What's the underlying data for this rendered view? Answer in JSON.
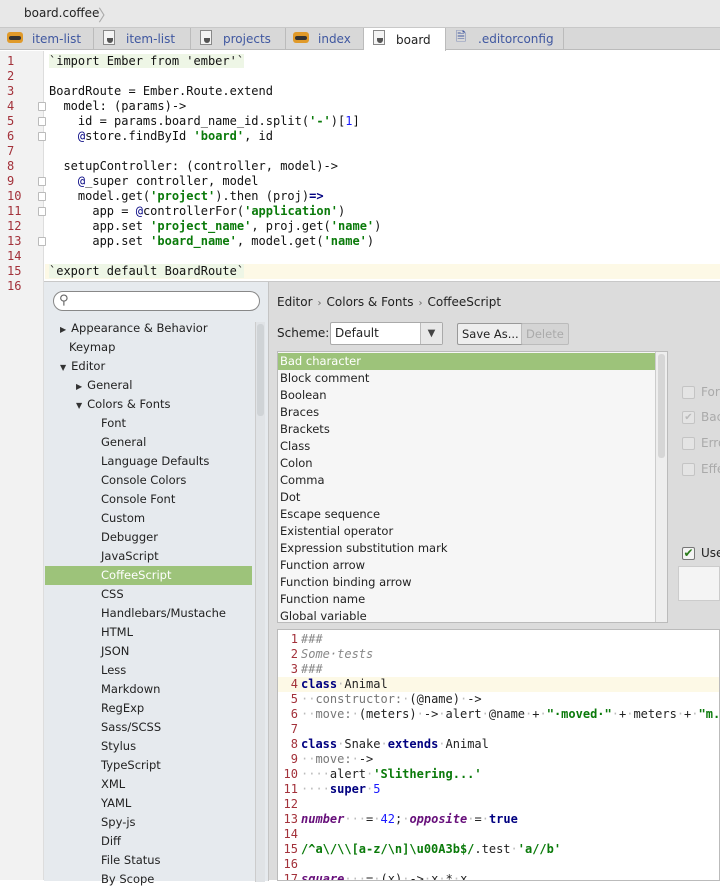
{
  "breadcrumb": {
    "file": "board.coffee"
  },
  "tabs": [
    {
      "label": "item-list",
      "icon": "mustache"
    },
    {
      "label": "item-list",
      "icon": "coffee-file"
    },
    {
      "label": "projects",
      "icon": "coffee-file"
    },
    {
      "label": "index",
      "icon": "mustache"
    },
    {
      "label": "board",
      "icon": "coffee-file",
      "active": true
    },
    {
      "label": ".editorconfig",
      "icon": "text-file"
    }
  ],
  "editor": {
    "line_numbers": [
      "1",
      "2",
      "3",
      "4",
      "5",
      "6",
      "7",
      "8",
      "9",
      "10",
      "11",
      "12",
      "13",
      "14",
      "15",
      "16"
    ],
    "current_line": 15,
    "lines": [
      [
        [
          "`import Ember from 'ember'`",
          "js"
        ]
      ],
      [],
      [
        [
          "BoardRoute = Ember.Route.extend",
          ""
        ]
      ],
      [
        [
          "  model: (params)->",
          ""
        ]
      ],
      [
        [
          "    id = params.board_name_id.split(",
          ""
        ],
        [
          "'-'",
          "str"
        ],
        [
          ")[",
          ""
        ],
        [
          "1",
          "num"
        ],
        [
          "]",
          ""
        ]
      ],
      [
        [
          "    ",
          ""
        ],
        [
          "@",
          "at"
        ],
        [
          "store.findById ",
          ""
        ],
        [
          "'board'",
          "str"
        ],
        [
          ", id",
          ""
        ]
      ],
      [],
      [
        [
          "  setupController: (controller, model)->",
          ""
        ]
      ],
      [
        [
          "    ",
          ""
        ],
        [
          "@",
          "at"
        ],
        [
          "_super controller, model",
          ""
        ]
      ],
      [
        [
          "    model.get(",
          ""
        ],
        [
          "'project'",
          "str"
        ],
        [
          ").then (proj)",
          ""
        ],
        [
          "=>",
          "kw"
        ]
      ],
      [
        [
          "      app = ",
          ""
        ],
        [
          "@",
          "at"
        ],
        [
          "controllerFor(",
          ""
        ],
        [
          "'application'",
          "str"
        ],
        [
          ")",
          ""
        ]
      ],
      [
        [
          "      app.set ",
          ""
        ],
        [
          "'project_name'",
          "str"
        ],
        [
          ", proj.get(",
          ""
        ],
        [
          "'name'",
          "str"
        ],
        [
          ")",
          ""
        ]
      ],
      [
        [
          "      app.set ",
          ""
        ],
        [
          "'board_name'",
          "str"
        ],
        [
          ", model.get(",
          ""
        ],
        [
          "'name'",
          "str"
        ],
        [
          ")",
          ""
        ]
      ],
      [],
      [
        [
          "`export default BoardRoute`",
          "js"
        ]
      ],
      []
    ]
  },
  "settings": {
    "search": {
      "value": "",
      "placeholder": ""
    },
    "tree": [
      {
        "label": "Appearance & Behavior",
        "level": 0,
        "arrow": "collapsed"
      },
      {
        "label": "Keymap",
        "level": 0
      },
      {
        "label": "Editor",
        "level": 0,
        "arrow": "expanded"
      },
      {
        "label": "General",
        "level": 1,
        "arrow": "collapsed"
      },
      {
        "label": "Colors & Fonts",
        "level": 1,
        "arrow": "expanded"
      },
      {
        "label": "Font",
        "level": 2
      },
      {
        "label": "General",
        "level": 2
      },
      {
        "label": "Language Defaults",
        "level": 2
      },
      {
        "label": "Console Colors",
        "level": 2
      },
      {
        "label": "Console Font",
        "level": 2
      },
      {
        "label": "Custom",
        "level": 2
      },
      {
        "label": "Debugger",
        "level": 2
      },
      {
        "label": "JavaScript",
        "level": 2
      },
      {
        "label": "CoffeeScript",
        "level": 2,
        "selected": true
      },
      {
        "label": "CSS",
        "level": 2
      },
      {
        "label": "Handlebars/Mustache",
        "level": 2
      },
      {
        "label": "HTML",
        "level": 2
      },
      {
        "label": "JSON",
        "level": 2
      },
      {
        "label": "Less",
        "level": 2
      },
      {
        "label": "Markdown",
        "level": 2
      },
      {
        "label": "RegExp",
        "level": 2
      },
      {
        "label": "Sass/SCSS",
        "level": 2
      },
      {
        "label": "Stylus",
        "level": 2
      },
      {
        "label": "TypeScript",
        "level": 2
      },
      {
        "label": "XML",
        "level": 2
      },
      {
        "label": "YAML",
        "level": 2
      },
      {
        "label": "Spy-js",
        "level": 2
      },
      {
        "label": "Diff",
        "level": 2
      },
      {
        "label": "File Status",
        "level": 2
      },
      {
        "label": "By Scope",
        "level": 2
      }
    ],
    "path": [
      "Editor",
      "Colors & Fonts",
      "CoffeeScript"
    ],
    "path_sep": "›",
    "scheme_label": "Scheme:",
    "scheme_value": "Default",
    "save_as": "Save As...",
    "delete": "Delete",
    "attributes": [
      "Bad character",
      "Block comment",
      "Boolean",
      "Braces",
      "Brackets",
      "Class",
      "Colon",
      "Comma",
      "Dot",
      "Escape sequence",
      "Existential operator",
      "Expression substitution mark",
      "Function arrow",
      "Function binding arrow",
      "Function name",
      "Global variable"
    ],
    "selected_attribute": "Bad character",
    "options": [
      {
        "label": "For",
        "checked": false,
        "enabled": false
      },
      {
        "label": "Bac",
        "checked": true,
        "enabled": false
      },
      {
        "label": "Erro",
        "checked": false,
        "enabled": false
      },
      {
        "label": "Effe",
        "checked": false,
        "enabled": false
      },
      {
        "label": "Use",
        "checked": true,
        "enabled": true
      }
    ],
    "accent": "#9dc37a"
  },
  "preview": {
    "current_line": 4,
    "lines": [
      [
        [
          "###",
          "cm"
        ]
      ],
      [
        [
          "Some·tests",
          "cm"
        ]
      ],
      [
        [
          "###",
          "cm"
        ]
      ],
      [
        [
          "class",
          "kw"
        ],
        [
          "·",
          "ws"
        ],
        [
          "Animal",
          ""
        ]
      ],
      [
        [
          "··",
          "ws"
        ],
        [
          "constructor:",
          "var2"
        ],
        [
          "·",
          "ws"
        ],
        [
          "(@name)",
          ""
        ],
        [
          "·",
          "ws"
        ],
        [
          "->",
          ""
        ]
      ],
      [
        [
          "··",
          "ws"
        ],
        [
          "move:",
          ""
        ],
        [
          "·",
          "ws"
        ],
        [
          "(meters)",
          ""
        ],
        [
          "·",
          "ws"
        ],
        [
          "->",
          ""
        ],
        [
          "·",
          "ws"
        ],
        [
          "alert",
          ""
        ],
        [
          "·",
          "ws"
        ],
        [
          "@name",
          ""
        ],
        [
          "·",
          "ws"
        ],
        [
          "+",
          ""
        ],
        [
          "·",
          "ws"
        ],
        [
          "\"·moved·\"",
          "str"
        ],
        [
          "·",
          "ws"
        ],
        [
          "+",
          ""
        ],
        [
          "·",
          "ws"
        ],
        [
          "meters",
          ""
        ],
        [
          "·",
          "ws"
        ],
        [
          "+",
          ""
        ],
        [
          "·",
          "ws"
        ],
        [
          "\"m.\"",
          "str"
        ]
      ],
      [],
      [
        [
          "class",
          "kw"
        ],
        [
          "·",
          "ws"
        ],
        [
          "Snake",
          ""
        ],
        [
          "·",
          "ws"
        ],
        [
          "extends",
          "kw"
        ],
        [
          "·",
          "ws"
        ],
        [
          "Animal",
          ""
        ]
      ],
      [
        [
          "··",
          "ws"
        ],
        [
          "move:",
          ""
        ],
        [
          "·",
          "ws"
        ],
        [
          "->",
          ""
        ]
      ],
      [
        [
          "····",
          "ws"
        ],
        [
          "alert",
          ""
        ],
        [
          "·",
          "ws"
        ],
        [
          "'Slithering...'",
          "str"
        ]
      ],
      [
        [
          "····",
          "ws"
        ],
        [
          "super",
          "kw"
        ],
        [
          "·",
          "ws"
        ],
        [
          "5",
          "num"
        ]
      ],
      [],
      [
        [
          "number",
          "var"
        ],
        [
          "···",
          "ws"
        ],
        [
          "=",
          ""
        ],
        [
          "·",
          "ws"
        ],
        [
          "42",
          "num"
        ],
        [
          ";",
          ""
        ],
        [
          "·",
          "ws"
        ],
        [
          "opposite",
          "var"
        ],
        [
          "·",
          "ws"
        ],
        [
          "=",
          ""
        ],
        [
          "·",
          "ws"
        ],
        [
          "true",
          "kw"
        ]
      ],
      [],
      [
        [
          "/^a\\/\\\\[a-z/\\n]\\u00A3b$/",
          "str"
        ],
        [
          ".test",
          ""
        ],
        [
          "·",
          "ws"
        ],
        [
          "'a//b'",
          "str"
        ]
      ],
      [],
      [
        [
          "square",
          "var"
        ],
        [
          "···",
          "ws"
        ],
        [
          "=",
          ""
        ],
        [
          "·",
          "ws"
        ],
        [
          "(x)",
          ""
        ],
        [
          "·",
          "ws"
        ],
        [
          "->",
          ""
        ],
        [
          "·",
          "ws"
        ],
        [
          "x",
          ""
        ],
        [
          "·",
          "ws"
        ],
        [
          "*",
          ""
        ],
        [
          "·",
          "ws"
        ],
        [
          "x",
          ""
        ]
      ]
    ]
  }
}
